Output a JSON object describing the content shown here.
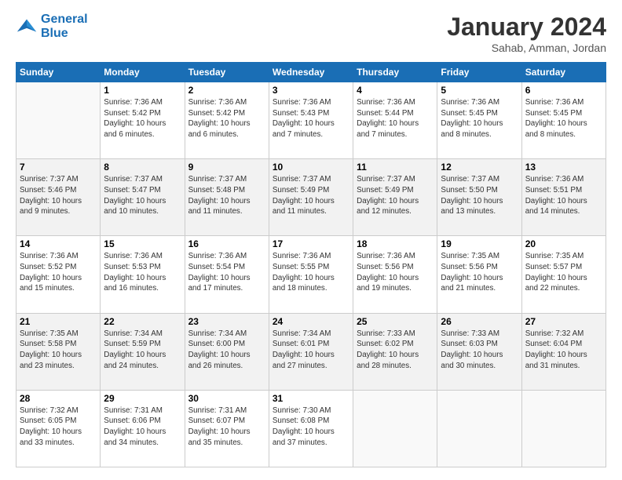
{
  "logo": {
    "line1": "General",
    "line2": "Blue"
  },
  "title": "January 2024",
  "location": "Sahab, Amman, Jordan",
  "weekdays": [
    "Sunday",
    "Monday",
    "Tuesday",
    "Wednesday",
    "Thursday",
    "Friday",
    "Saturday"
  ],
  "weeks": [
    [
      {
        "day": "",
        "info": ""
      },
      {
        "day": "1",
        "info": "Sunrise: 7:36 AM\nSunset: 5:42 PM\nDaylight: 10 hours\nand 6 minutes."
      },
      {
        "day": "2",
        "info": "Sunrise: 7:36 AM\nSunset: 5:42 PM\nDaylight: 10 hours\nand 6 minutes."
      },
      {
        "day": "3",
        "info": "Sunrise: 7:36 AM\nSunset: 5:43 PM\nDaylight: 10 hours\nand 7 minutes."
      },
      {
        "day": "4",
        "info": "Sunrise: 7:36 AM\nSunset: 5:44 PM\nDaylight: 10 hours\nand 7 minutes."
      },
      {
        "day": "5",
        "info": "Sunrise: 7:36 AM\nSunset: 5:45 PM\nDaylight: 10 hours\nand 8 minutes."
      },
      {
        "day": "6",
        "info": "Sunrise: 7:36 AM\nSunset: 5:45 PM\nDaylight: 10 hours\nand 8 minutes."
      }
    ],
    [
      {
        "day": "7",
        "info": "Sunrise: 7:37 AM\nSunset: 5:46 PM\nDaylight: 10 hours\nand 9 minutes."
      },
      {
        "day": "8",
        "info": "Sunrise: 7:37 AM\nSunset: 5:47 PM\nDaylight: 10 hours\nand 10 minutes."
      },
      {
        "day": "9",
        "info": "Sunrise: 7:37 AM\nSunset: 5:48 PM\nDaylight: 10 hours\nand 11 minutes."
      },
      {
        "day": "10",
        "info": "Sunrise: 7:37 AM\nSunset: 5:49 PM\nDaylight: 10 hours\nand 11 minutes."
      },
      {
        "day": "11",
        "info": "Sunrise: 7:37 AM\nSunset: 5:49 PM\nDaylight: 10 hours\nand 12 minutes."
      },
      {
        "day": "12",
        "info": "Sunrise: 7:37 AM\nSunset: 5:50 PM\nDaylight: 10 hours\nand 13 minutes."
      },
      {
        "day": "13",
        "info": "Sunrise: 7:36 AM\nSunset: 5:51 PM\nDaylight: 10 hours\nand 14 minutes."
      }
    ],
    [
      {
        "day": "14",
        "info": "Sunrise: 7:36 AM\nSunset: 5:52 PM\nDaylight: 10 hours\nand 15 minutes."
      },
      {
        "day": "15",
        "info": "Sunrise: 7:36 AM\nSunset: 5:53 PM\nDaylight: 10 hours\nand 16 minutes."
      },
      {
        "day": "16",
        "info": "Sunrise: 7:36 AM\nSunset: 5:54 PM\nDaylight: 10 hours\nand 17 minutes."
      },
      {
        "day": "17",
        "info": "Sunrise: 7:36 AM\nSunset: 5:55 PM\nDaylight: 10 hours\nand 18 minutes."
      },
      {
        "day": "18",
        "info": "Sunrise: 7:36 AM\nSunset: 5:56 PM\nDaylight: 10 hours\nand 19 minutes."
      },
      {
        "day": "19",
        "info": "Sunrise: 7:35 AM\nSunset: 5:56 PM\nDaylight: 10 hours\nand 21 minutes."
      },
      {
        "day": "20",
        "info": "Sunrise: 7:35 AM\nSunset: 5:57 PM\nDaylight: 10 hours\nand 22 minutes."
      }
    ],
    [
      {
        "day": "21",
        "info": "Sunrise: 7:35 AM\nSunset: 5:58 PM\nDaylight: 10 hours\nand 23 minutes."
      },
      {
        "day": "22",
        "info": "Sunrise: 7:34 AM\nSunset: 5:59 PM\nDaylight: 10 hours\nand 24 minutes."
      },
      {
        "day": "23",
        "info": "Sunrise: 7:34 AM\nSunset: 6:00 PM\nDaylight: 10 hours\nand 26 minutes."
      },
      {
        "day": "24",
        "info": "Sunrise: 7:34 AM\nSunset: 6:01 PM\nDaylight: 10 hours\nand 27 minutes."
      },
      {
        "day": "25",
        "info": "Sunrise: 7:33 AM\nSunset: 6:02 PM\nDaylight: 10 hours\nand 28 minutes."
      },
      {
        "day": "26",
        "info": "Sunrise: 7:33 AM\nSunset: 6:03 PM\nDaylight: 10 hours\nand 30 minutes."
      },
      {
        "day": "27",
        "info": "Sunrise: 7:32 AM\nSunset: 6:04 PM\nDaylight: 10 hours\nand 31 minutes."
      }
    ],
    [
      {
        "day": "28",
        "info": "Sunrise: 7:32 AM\nSunset: 6:05 PM\nDaylight: 10 hours\nand 33 minutes."
      },
      {
        "day": "29",
        "info": "Sunrise: 7:31 AM\nSunset: 6:06 PM\nDaylight: 10 hours\nand 34 minutes."
      },
      {
        "day": "30",
        "info": "Sunrise: 7:31 AM\nSunset: 6:07 PM\nDaylight: 10 hours\nand 35 minutes."
      },
      {
        "day": "31",
        "info": "Sunrise: 7:30 AM\nSunset: 6:08 PM\nDaylight: 10 hours\nand 37 minutes."
      },
      {
        "day": "",
        "info": ""
      },
      {
        "day": "",
        "info": ""
      },
      {
        "day": "",
        "info": ""
      }
    ]
  ]
}
